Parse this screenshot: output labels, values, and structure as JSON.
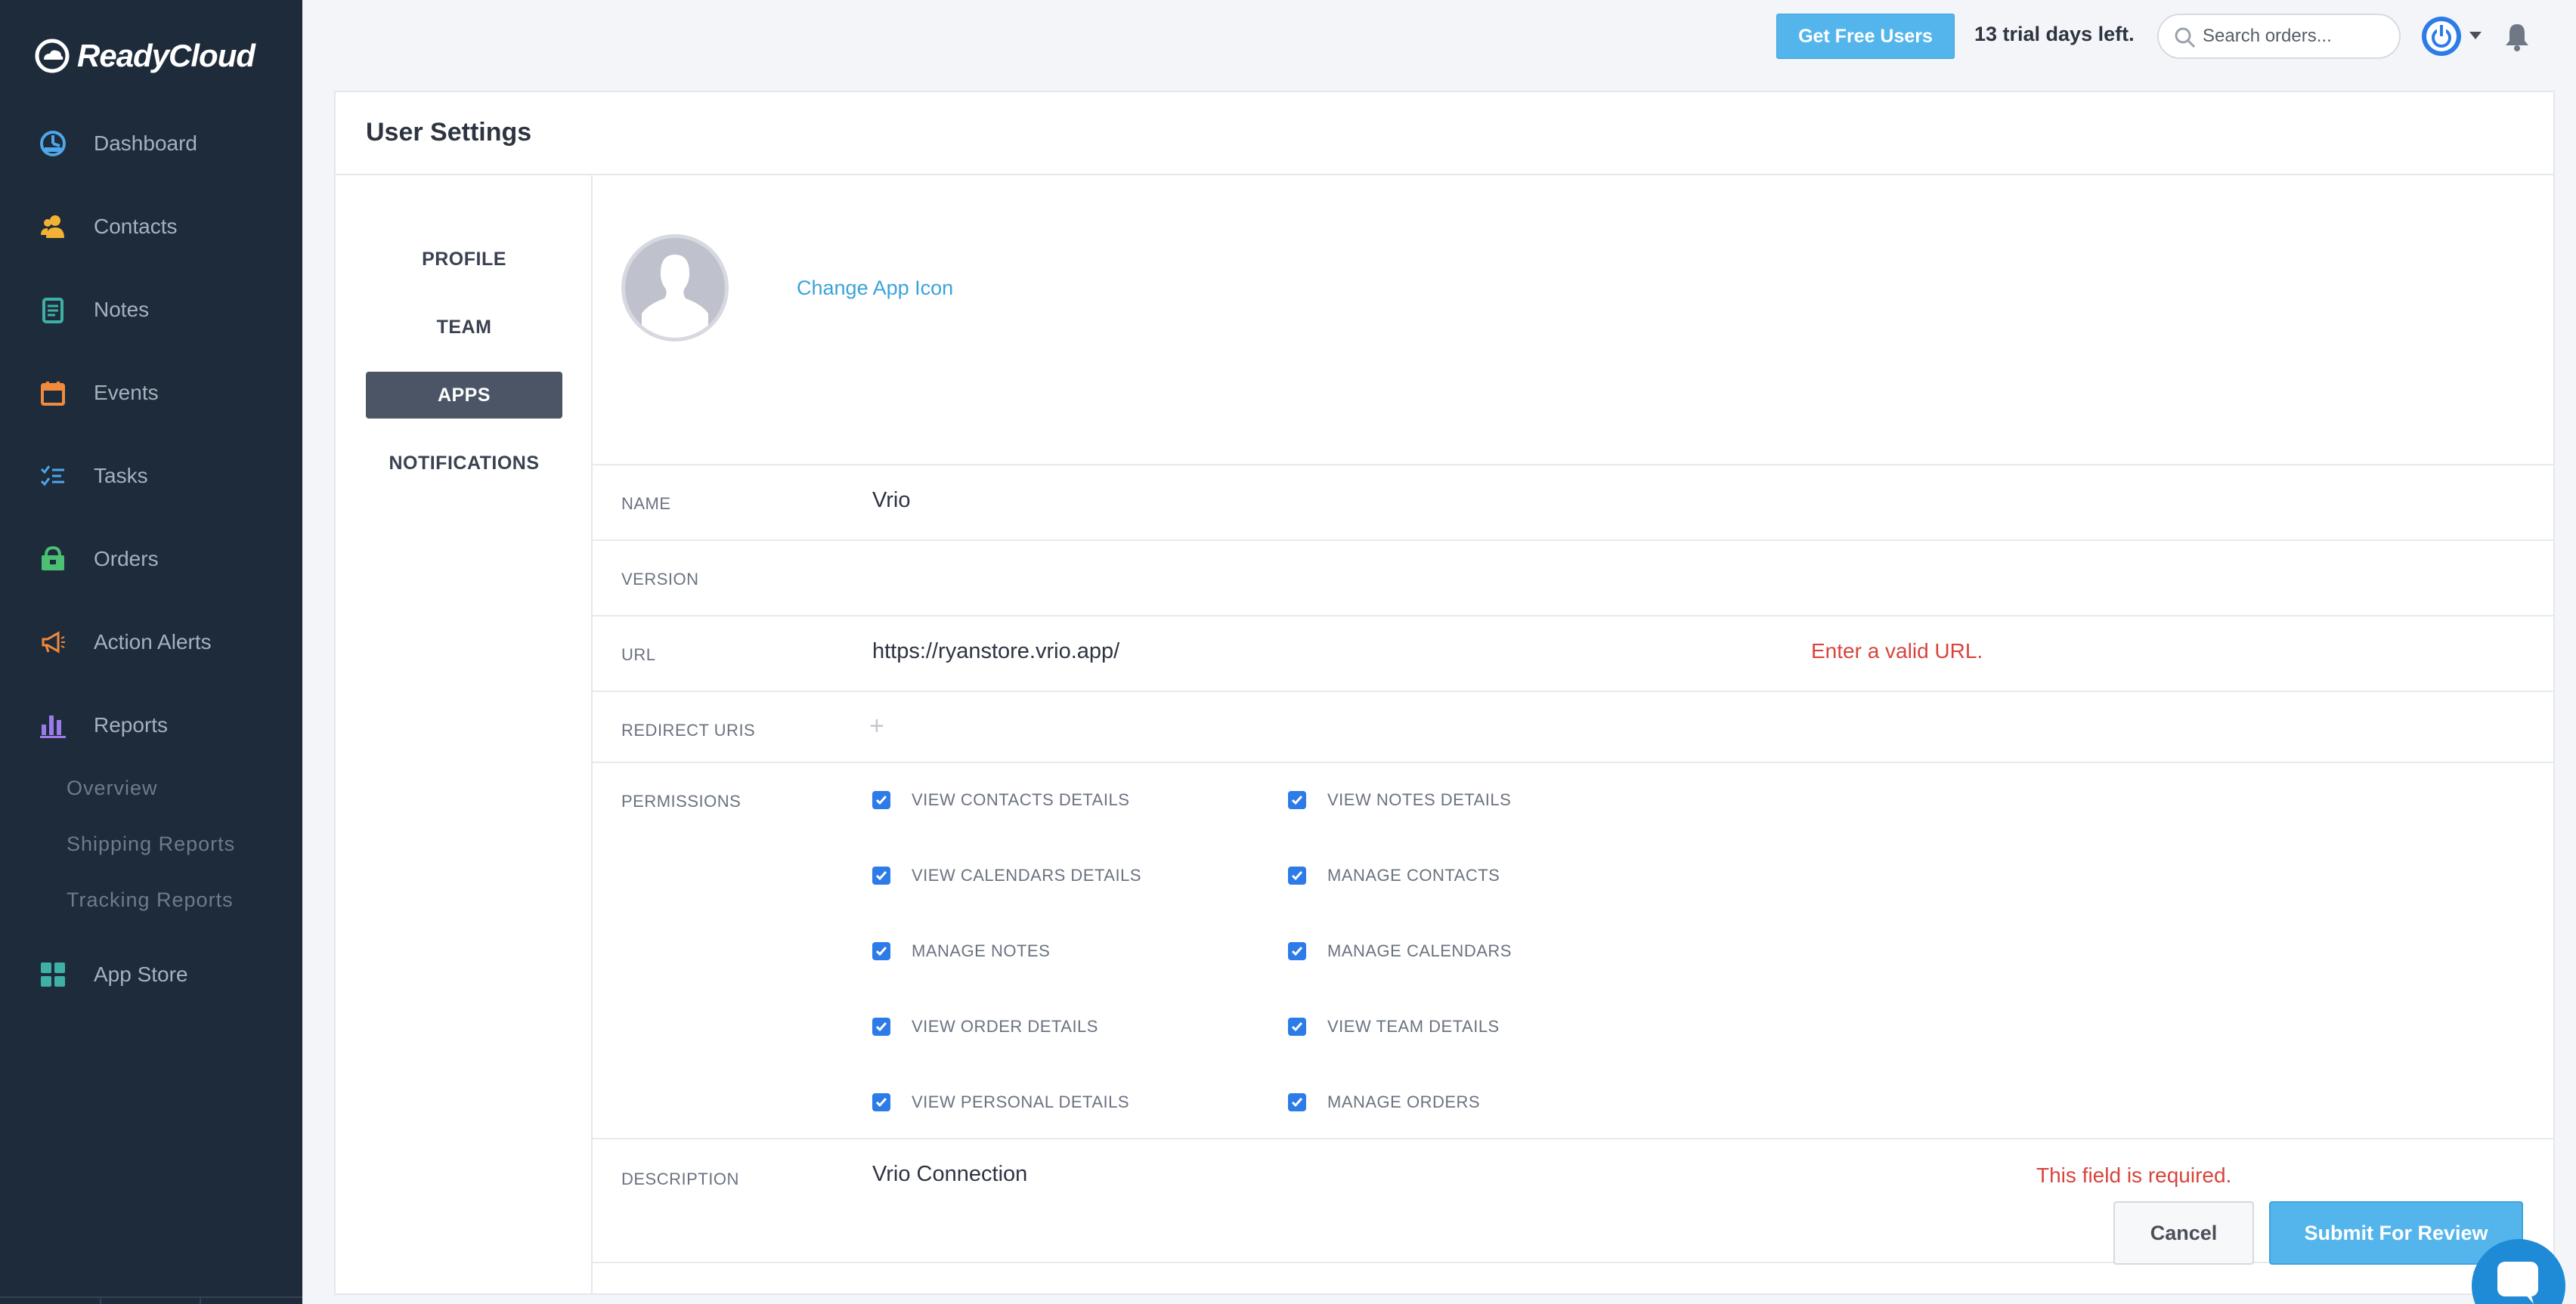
{
  "brand": {
    "name": "ReadyCloud"
  },
  "sidebar": {
    "items": [
      {
        "label": "Dashboard",
        "icon": "dashboard-icon"
      },
      {
        "label": "Contacts",
        "icon": "contacts-icon"
      },
      {
        "label": "Notes",
        "icon": "notes-icon"
      },
      {
        "label": "Events",
        "icon": "calendar-icon"
      },
      {
        "label": "Tasks",
        "icon": "tasks-icon"
      },
      {
        "label": "Orders",
        "icon": "orders-icon"
      },
      {
        "label": "Action Alerts",
        "icon": "megaphone-icon"
      },
      {
        "label": "Reports",
        "icon": "bar-chart-icon"
      },
      {
        "label": "App Store",
        "icon": "grid-icon"
      }
    ],
    "report_subitems": [
      {
        "label": "Overview"
      },
      {
        "label": "Shipping Reports"
      },
      {
        "label": "Tracking Reports"
      }
    ]
  },
  "topbar": {
    "get_free_users": "Get Free Users",
    "trial_text": "13 trial days left.",
    "search_placeholder": "Search orders..."
  },
  "page": {
    "title": "User Settings",
    "tabs": [
      {
        "label": "PROFILE"
      },
      {
        "label": "TEAM"
      },
      {
        "label": "APPS",
        "active": true
      },
      {
        "label": "NOTIFICATIONS"
      }
    ]
  },
  "app_form": {
    "change_icon_link": "Change App Icon",
    "name_label": "NAME",
    "name_value": "Vrio",
    "version_label": "VERSION",
    "version_value": "",
    "url_label": "URL",
    "url_value": "https://ryanstore.vrio.app/",
    "url_error": "Enter a valid URL.",
    "redirect_label": "REDIRECT URIS",
    "redirect_add": "+",
    "permissions_label": "PERMISSIONS",
    "permissions": [
      {
        "label": "VIEW CONTACTS DETAILS",
        "checked": true
      },
      {
        "label": "VIEW NOTES DETAILS",
        "checked": true
      },
      {
        "label": "VIEW CALENDARS DETAILS",
        "checked": true
      },
      {
        "label": "MANAGE CONTACTS",
        "checked": true
      },
      {
        "label": "MANAGE NOTES",
        "checked": true
      },
      {
        "label": "MANAGE CALENDARS",
        "checked": true
      },
      {
        "label": "VIEW ORDER DETAILS",
        "checked": true
      },
      {
        "label": "VIEW TEAM DETAILS",
        "checked": true
      },
      {
        "label": "VIEW PERSONAL DETAILS",
        "checked": true
      },
      {
        "label": "MANAGE ORDERS",
        "checked": true
      }
    ],
    "description_label": "DESCRIPTION",
    "description_value": "Vrio Connection",
    "description_error": "This field is required.",
    "cancel": "Cancel",
    "submit": "Submit For Review"
  },
  "colors": {
    "sidebar_bg": "#1e2b3b",
    "accent": "#54b5ec",
    "link": "#3aa3dc",
    "error": "#d8443c",
    "checkbox": "#2d7be8",
    "active_tab": "#4b5566"
  }
}
